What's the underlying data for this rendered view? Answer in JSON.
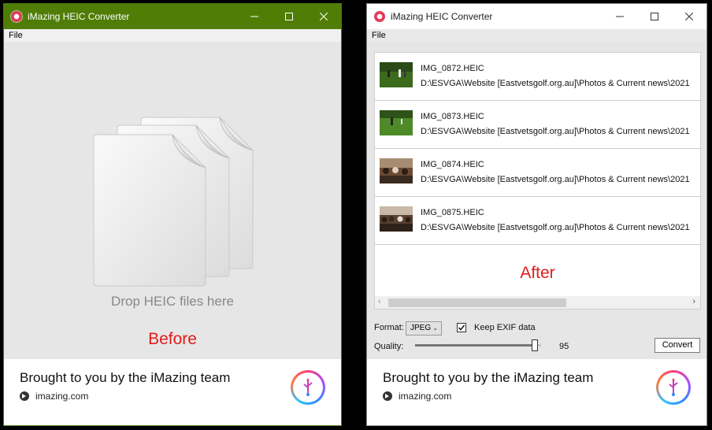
{
  "before": {
    "title": "iMazing HEIC Converter",
    "menu_file": "File",
    "drop_label": "Drop HEIC files here",
    "caption": "Before",
    "footer_text": "Brought to you by the iMazing team",
    "footer_link": "imazing.com"
  },
  "after": {
    "title": "iMazing HEIC Converter",
    "menu_file": "File",
    "files": [
      {
        "name": "IMG_0872.HEIC",
        "path": "D:\\ESVGA\\Website [Eastvetsgolf.org.au]\\Photos & Current news\\2021",
        "thumb": "golf-green-icon"
      },
      {
        "name": "IMG_0873.HEIC",
        "path": "D:\\ESVGA\\Website [Eastvetsgolf.org.au]\\Photos & Current news\\2021",
        "thumb": "golf-green-icon"
      },
      {
        "name": "IMG_0874.HEIC",
        "path": "D:\\ESVGA\\Website [Eastvetsgolf.org.au]\\Photos & Current news\\2021",
        "thumb": "group-indoor-icon"
      },
      {
        "name": "IMG_0875.HEIC",
        "path": "D:\\ESVGA\\Website [Eastvetsgolf.org.au]\\Photos & Current news\\2021",
        "thumb": "group-indoor-icon"
      }
    ],
    "caption": "After",
    "format_label": "Format:",
    "format_value": "JPEG",
    "keep_exif_label": "Keep EXIF data",
    "keep_exif_checked": true,
    "quality_label": "Quality:",
    "quality_value": "95",
    "convert_label": "Convert",
    "footer_text": "Brought to you by the iMazing team",
    "footer_link": "imazing.com"
  },
  "colors": {
    "titlebar_active": "#4f7d06",
    "caption_red": "#e21b1b"
  }
}
